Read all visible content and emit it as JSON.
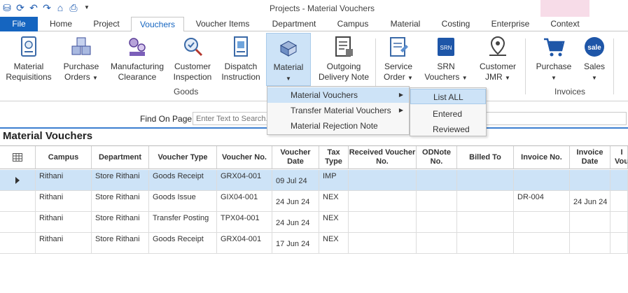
{
  "window": {
    "title": "Projects - Material Vouchers"
  },
  "tabs": [
    "File",
    "Home",
    "Project",
    "Vouchers",
    "Voucher Items",
    "Department",
    "Campus",
    "Material",
    "Costing",
    "Enterprise",
    "Context"
  ],
  "ribbon": {
    "buttons": [
      {
        "l1": "Material",
        "l2": "Requisitions"
      },
      {
        "l1": "Purchase",
        "l2": "Orders"
      },
      {
        "l1": "Manufacturing",
        "l2": "Clearance"
      },
      {
        "l1": "Customer",
        "l2": "Inspection"
      },
      {
        "l1": "Dispatch",
        "l2": "Instruction"
      },
      {
        "l1": "Material",
        "l2": ""
      },
      {
        "l1": "Outgoing",
        "l2": "Delivery Note"
      },
      {
        "l1": "Service",
        "l2": "Order"
      },
      {
        "l1": "SRN",
        "l2": "Vouchers"
      },
      {
        "l1": "Customer",
        "l2": "JMR"
      },
      {
        "l1": "Purchase",
        "l2": ""
      },
      {
        "l1": "Sales",
        "l2": ""
      }
    ],
    "groups": [
      "Goods",
      "Invoices"
    ],
    "sales_badge": "sale",
    "srn_badge": "SRN"
  },
  "find": {
    "label": "Find On Page",
    "placeholder": "Enter Text to Search..."
  },
  "page_heading": "Material Vouchers",
  "columns": [
    "Campus",
    "Department",
    "Voucher Type",
    "Voucher No.",
    "Voucher Date",
    "Tax Type",
    "Received Voucher No.",
    "ODNote No.",
    "Billed To",
    "Invoice No.",
    "Invoice Date",
    "I Vou"
  ],
  "rows": [
    {
      "campus": "Rithani",
      "department": "Store Rithani",
      "type": "Goods Receipt",
      "no": "GRX04-001",
      "date": "09 Jul 24",
      "tax": "IMP",
      "invoice_no": "",
      "invoice_date": ""
    },
    {
      "campus": "Rithani",
      "department": "Store Rithani",
      "type": "Goods Issue",
      "no": "GIX04-001",
      "date": "24 Jun 24",
      "tax": "NEX",
      "invoice_no": "DR-004",
      "invoice_date": "24 Jun 24"
    },
    {
      "campus": "Rithani",
      "department": "Store Rithani",
      "type": "Transfer Posting",
      "no": "TPX04-001",
      "date": "24 Jun 24",
      "tax": "NEX",
      "invoice_no": "",
      "invoice_date": ""
    },
    {
      "campus": "Rithani",
      "department": "Store Rithani",
      "type": "Goods Receipt",
      "no": "GRX04-001",
      "date": "17 Jun 24",
      "tax": "NEX",
      "invoice_no": "",
      "invoice_date": ""
    }
  ],
  "menu": {
    "items": [
      "Material Vouchers",
      "Transfer Material Vouchers",
      "Material Rejection Note"
    ],
    "submenu": [
      "List ALL",
      "Entered",
      "Reviewed"
    ]
  },
  "colors": {
    "accent": "#1565c0",
    "selection": "#cde3f7",
    "context": "#f7dce8"
  }
}
